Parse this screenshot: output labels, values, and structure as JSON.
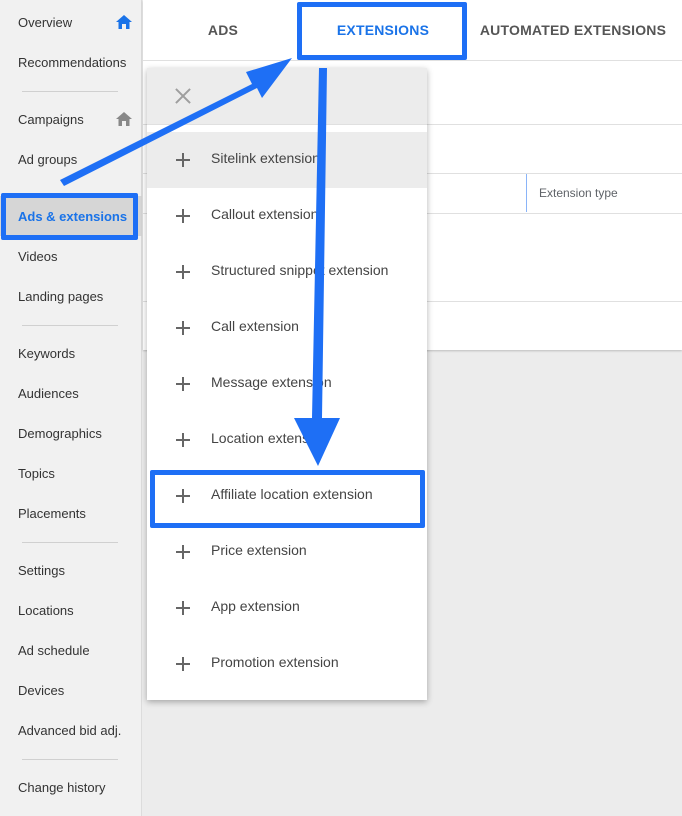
{
  "sidebar": {
    "items": [
      {
        "label": "Overview",
        "home": true
      },
      {
        "label": "Recommendations"
      },
      {
        "label": "Campaigns",
        "home": true
      },
      {
        "label": "Ad groups"
      },
      {
        "label": "Ads & extensions",
        "active": true
      },
      {
        "label": "Videos"
      },
      {
        "label": "Landing pages"
      },
      {
        "label": "Keywords"
      },
      {
        "label": "Audiences"
      },
      {
        "label": "Demographics"
      },
      {
        "label": "Topics"
      },
      {
        "label": "Placements"
      },
      {
        "label": "Settings"
      },
      {
        "label": "Locations"
      },
      {
        "label": "Ad schedule"
      },
      {
        "label": "Devices"
      },
      {
        "label": "Advanced bid adj."
      },
      {
        "label": "Change history"
      }
    ]
  },
  "tabs": [
    {
      "label": "ADS"
    },
    {
      "label": "EXTENSIONS",
      "active": true
    },
    {
      "label": "AUTOMATED EXTENSIONS"
    }
  ],
  "table": {
    "column_header": "Extension type"
  },
  "menu": {
    "items": [
      {
        "label": "Sitelink extension"
      },
      {
        "label": "Callout extension"
      },
      {
        "label": "Structured snippet extension"
      },
      {
        "label": "Call extension"
      },
      {
        "label": "Message extension"
      },
      {
        "label": "Location extension"
      },
      {
        "label": "Affiliate location extension",
        "highlighted": true
      },
      {
        "label": "Price extension"
      },
      {
        "label": "App extension"
      },
      {
        "label": "Promotion extension"
      }
    ]
  },
  "colors": {
    "accent": "#1a73e8",
    "annotation": "#1e6ff5"
  }
}
